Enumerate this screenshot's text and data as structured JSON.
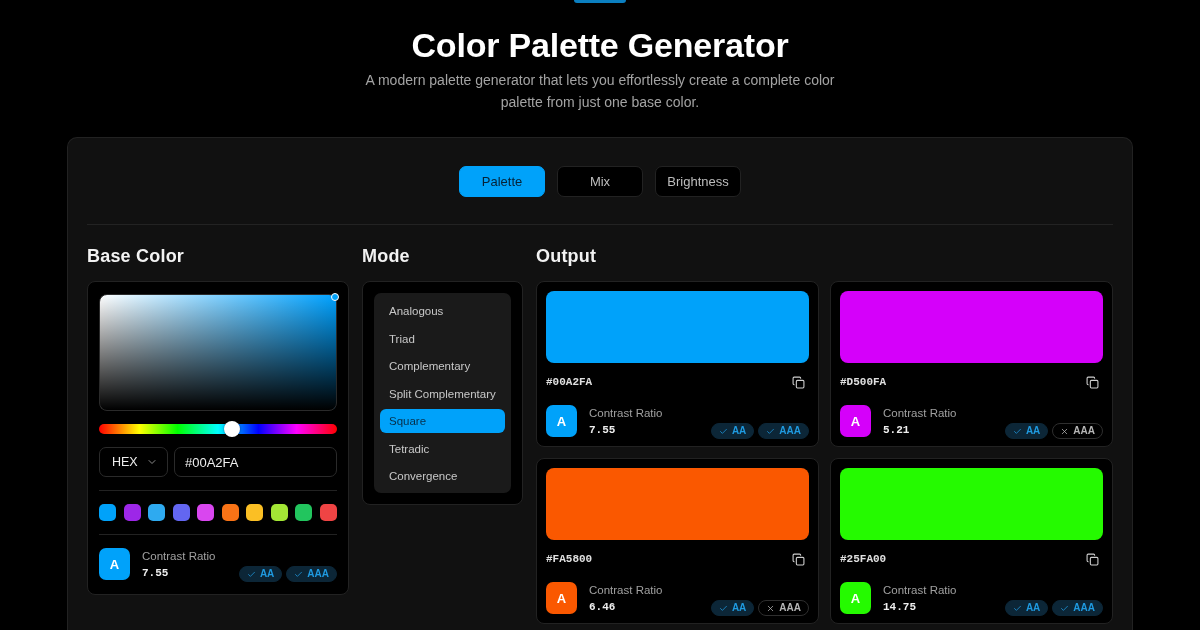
{
  "header": {
    "title": "Color Palette Generator",
    "subtitle": "A modern palette generator that lets you effortlessly create a complete color palette from just one base color."
  },
  "tabs": [
    {
      "label": "Palette",
      "selected": true
    },
    {
      "label": "Mix",
      "selected": false
    },
    {
      "label": "Brightness",
      "selected": false
    }
  ],
  "base_color": {
    "heading": "Base Color",
    "color": "#00a2fa",
    "hue": {
      "level": 0.56
    },
    "format": "HEX",
    "value": "#00A2FA",
    "swatches": [
      {
        "color": "#00a2fa"
      },
      {
        "color": "#9d27e8"
      },
      {
        "color": "#2eaaf0"
      },
      {
        "color": "#6366f1"
      },
      {
        "color": "#d946ef"
      },
      {
        "color": "#f97316"
      },
      {
        "color": "#fbbf24"
      },
      {
        "color": "#a3e635"
      },
      {
        "color": "#22c55e"
      },
      {
        "color": "#ef4444"
      }
    ],
    "contrast": {
      "sample": "A",
      "label": "Contrast Ratio",
      "ratio": "7.55",
      "badges": [
        {
          "label": "AA",
          "passed": true
        },
        {
          "label": "AAA",
          "passed": true
        }
      ]
    }
  },
  "mode": {
    "heading": "Mode",
    "items": [
      {
        "label": "Analogous",
        "selected": false
      },
      {
        "label": "Triad",
        "selected": false
      },
      {
        "label": "Complementary",
        "selected": false
      },
      {
        "label": "Split Complementary",
        "selected": false
      },
      {
        "label": "Square",
        "selected": true
      },
      {
        "label": "Tetradic",
        "selected": false
      },
      {
        "label": "Convergence",
        "selected": false
      }
    ]
  },
  "output": {
    "heading": "Output",
    "cards": [
      {
        "color": "#00a2fa",
        "hex": "#00A2FA",
        "contrast": {
          "sample": "A",
          "label": "Contrast Ratio",
          "ratio": "7.55",
          "badges": [
            {
              "label": "AA",
              "passed": true
            },
            {
              "label": "AAA",
              "passed": true
            }
          ]
        }
      },
      {
        "color": "#d500fa",
        "hex": "#D500FA",
        "contrast": {
          "sample": "A",
          "label": "Contrast Ratio",
          "ratio": "5.21",
          "badges": [
            {
              "label": "AA",
              "passed": true
            },
            {
              "label": "AAA",
              "passed": false
            }
          ]
        }
      },
      {
        "color": "#fa5800",
        "hex": "#FA5800",
        "contrast": {
          "sample": "A",
          "label": "Contrast Ratio",
          "ratio": "6.46",
          "badges": [
            {
              "label": "AA",
              "passed": true
            },
            {
              "label": "AAA",
              "passed": false
            }
          ]
        }
      },
      {
        "color": "#25fa00",
        "hex": "#25FA00",
        "contrast": {
          "sample": "A",
          "label": "Contrast Ratio",
          "ratio": "14.75",
          "badges": [
            {
              "label": "AA",
              "passed": true
            },
            {
              "label": "AAA",
              "passed": true
            }
          ]
        }
      }
    ]
  }
}
